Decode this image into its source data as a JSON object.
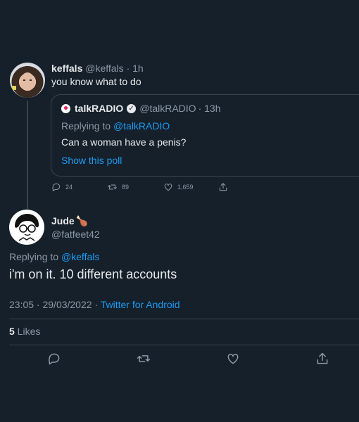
{
  "parent_tweet": {
    "name": "keffals",
    "handle": "@keffals",
    "time": "· 1h",
    "text": "you know what to do",
    "quoted": {
      "name": "talkRADIO",
      "handle": "@talkRADIO",
      "time": "· 13h",
      "replying_prefix": "Replying to ",
      "replying_to": "@talkRADIO",
      "text": "Can a woman have a penis?",
      "poll_link": "Show this poll"
    },
    "actions": {
      "replies": "24",
      "retweets": "89",
      "likes": "1,659"
    }
  },
  "main_tweet": {
    "name": "Jude",
    "handle": "@fatfeet42",
    "replying_prefix": "Replying to ",
    "replying_to": "@keffals",
    "text": "i'm on it. 10 different accounts",
    "datetime": "23:05 · 29/03/2022 · ",
    "source": "Twitter for Android",
    "like_count": "5",
    "like_label": " Likes"
  },
  "colors": {
    "background": "#15202b",
    "text": "#e7e9ea",
    "muted": "#8b98a5",
    "link": "#1d9bf0",
    "border": "#38444d"
  },
  "icons": [
    "reply-icon",
    "retweet-icon",
    "like-icon",
    "share-icon",
    "verified-icon",
    "drumstick-icon"
  ]
}
